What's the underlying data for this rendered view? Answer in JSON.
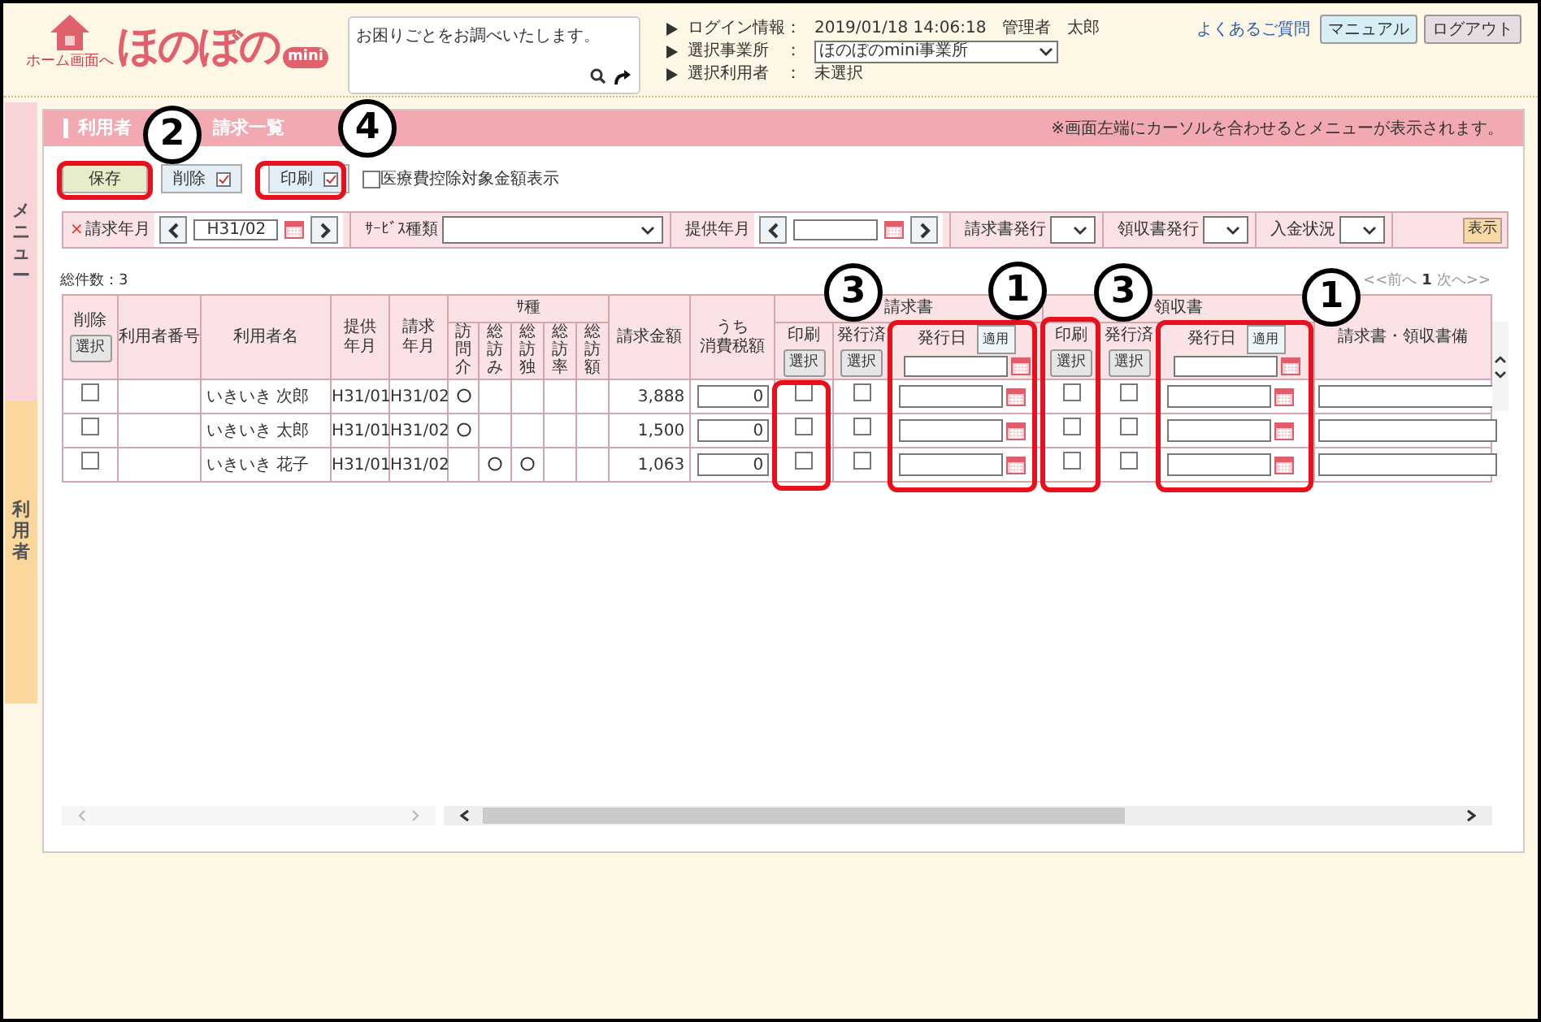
{
  "header": {
    "home_label": "ホーム画面へ",
    "logo": "ほのぼの",
    "logo_badge": "mini",
    "search_placeholder": "お困りごとをお調べいたします。",
    "info": [
      {
        "label": "ログイン情報：",
        "kind": "text",
        "value": "2019/01/18 14:06:18　管理者　太郎"
      },
      {
        "label": "選択事業所　：",
        "kind": "select",
        "value": "ほのぼのmini事業所"
      },
      {
        "label": "選択利用者　：",
        "kind": "text",
        "value": "未選択"
      }
    ],
    "faq_link": "よくあるご質問",
    "buttons": [
      "マニュアル",
      "ログアウト"
    ]
  },
  "side_tabs": [
    {
      "label": "メニュー",
      "color": "#f8d3d8"
    },
    {
      "label": "利用者",
      "color": "#fbd79c"
    }
  ],
  "panel": {
    "title_parts": [
      "利用者",
      "請求一覧"
    ],
    "notice": "※画面左端にカーソルを合わせるとメニューが表示されます。",
    "toolbar": [
      {
        "label": "保存",
        "kind": "save"
      },
      {
        "label": "削除",
        "kind": "check"
      },
      {
        "label": "印刷",
        "kind": "check"
      }
    ],
    "option": {
      "label": "医療費控除対象金額表示",
      "checked": false
    },
    "filters": [
      {
        "required_mark": "×",
        "label": "請求年月",
        "kind": "month",
        "value": "H31/02"
      },
      {
        "label": "ｻｰﾋﾞｽ種類",
        "kind": "wide_select"
      },
      {
        "label": "提供年月",
        "kind": "month"
      },
      {
        "label": "請求書発行",
        "kind": "select"
      },
      {
        "label": "領収書発行",
        "kind": "select"
      },
      {
        "label": "入金状況",
        "kind": "select"
      }
    ],
    "show_button": "表示",
    "count": "総件数：3",
    "pager": {
      "prev": "<<前へ",
      "page": "1",
      "next": "次へ>>"
    },
    "table": {
      "delete_header": "削除",
      "delete_select": "選択",
      "columns": [
        [
          "利用者番号"
        ],
        [
          "利用者名"
        ],
        [
          "提供",
          "年月"
        ],
        [
          "請求",
          "年月"
        ]
      ],
      "service_group": "ｻ種",
      "services": [
        "訪問介",
        "総訪み",
        "総訪独",
        "総訪率",
        "総訪額"
      ],
      "amount_header": [
        "請求金額"
      ],
      "tax_header": [
        "うち",
        "消費税額"
      ],
      "doc_groups": [
        {
          "title": "請求書",
          "print": "印刷",
          "print_select": "選択",
          "issued": "発行済",
          "issued_select": "選択",
          "date": "発行日",
          "apply": "適用"
        },
        {
          "title": "領収書",
          "print": "印刷",
          "print_select": "選択",
          "issued": "発行済",
          "issued_select": "選択",
          "date": "発行日",
          "apply": "適用"
        }
      ],
      "remarks_header": "請求書・領収書備",
      "rows": [
        {
          "delete": false,
          "name": "いきいき 次郎",
          "provided": "H31/01",
          "billed": "H31/02",
          "services": [
            true,
            false,
            false,
            false,
            false
          ],
          "amount": "3,888",
          "tax": "0",
          "docs": [
            {
              "print": false,
              "issued": false
            },
            {
              "print": false,
              "issued": false
            }
          ]
        },
        {
          "delete": false,
          "name": "いきいき 太郎",
          "provided": "H31/01",
          "billed": "H31/02",
          "services": [
            true,
            false,
            false,
            false,
            false
          ],
          "amount": "1,500",
          "tax": "0",
          "docs": [
            {
              "print": false,
              "issued": false
            },
            {
              "print": false,
              "issued": false
            }
          ]
        },
        {
          "delete": false,
          "name": "いきいき 花子",
          "provided": "H31/01",
          "billed": "H31/02",
          "services": [
            false,
            true,
            true,
            false,
            false
          ],
          "amount": "1,063",
          "tax": "0",
          "docs": [
            {
              "print": false,
              "issued": false
            },
            {
              "print": false,
              "issued": false
            }
          ]
        }
      ]
    }
  },
  "callouts": [
    {
      "number": "2"
    },
    {
      "number": "4"
    },
    {
      "number": "3"
    },
    {
      "number": "1"
    },
    {
      "number": "3"
    },
    {
      "number": "1"
    }
  ]
}
